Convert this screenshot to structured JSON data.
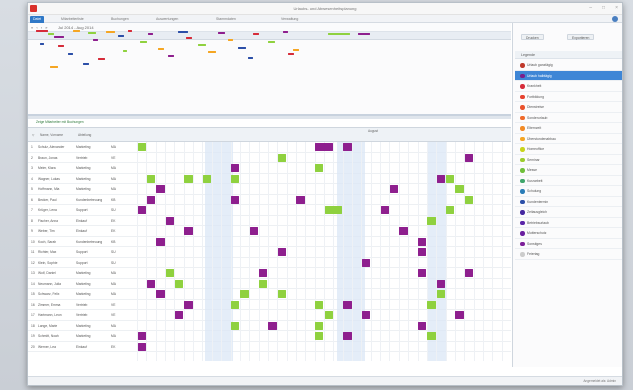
{
  "window": {
    "title": "Urlaubs- und Abwesenheitsplanung"
  },
  "ribbon": {
    "tabs": [
      {
        "label": "Datei",
        "active": true
      },
      {
        "label": "Mitarbeiterliste",
        "active": false
      },
      {
        "label": "Buchungen",
        "active": false
      },
      {
        "label": "Auswertungen",
        "active": false
      },
      {
        "label": "Stammdaten",
        "active": false
      },
      {
        "label": "Verwaltung",
        "active": false
      }
    ]
  },
  "nav": {
    "range": "Jul 2014 - Aug 2014"
  },
  "grid": {
    "caption": "Zeige Mitarbeiter mit Buchungen",
    "headers": {
      "name": "Name, Vorname",
      "dept": "Abteilung",
      "month": "August"
    },
    "rows": [
      {
        "n": "1",
        "name": "Schulz, Alexander",
        "dept": "Marketing",
        "code": "MA"
      },
      {
        "n": "2",
        "name": "Braun, Jonas",
        "dept": "Vertrieb",
        "code": "VE"
      },
      {
        "n": "3",
        "name": "Meier, Klara",
        "dept": "Marketing",
        "code": "MA"
      },
      {
        "n": "4",
        "name": "Wagner, Lukas",
        "dept": "Marketing",
        "code": "MA"
      },
      {
        "n": "5",
        "name": "Hoffmann, Mia",
        "dept": "Marketing",
        "code": "MA"
      },
      {
        "n": "6",
        "name": "Becker, Paul",
        "dept": "Kundenbetreuung",
        "code": "KB"
      },
      {
        "n": "7",
        "name": "Krüger, Lena",
        "dept": "Support",
        "code": "SU"
      },
      {
        "n": "8",
        "name": "Fischer, Anna",
        "dept": "Einkauf",
        "code": "EK"
      },
      {
        "n": "9",
        "name": "Weber, Tim",
        "dept": "Einkauf",
        "code": "EK"
      },
      {
        "n": "10",
        "name": "Koch, Sarah",
        "dept": "Kundenbetreuung",
        "code": "KB"
      },
      {
        "n": "11",
        "name": "Richter, Max",
        "dept": "Support",
        "code": "SU"
      },
      {
        "n": "12",
        "name": "Klein, Sophie",
        "dept": "Support",
        "code": "SU"
      },
      {
        "n": "13",
        "name": "Wolf, Daniel",
        "dept": "Marketing",
        "code": "MA"
      },
      {
        "n": "14",
        "name": "Neumann, Julia",
        "dept": "Marketing",
        "code": "MA"
      },
      {
        "n": "15",
        "name": "Schwarz, Felix",
        "dept": "Marketing",
        "code": "MA"
      },
      {
        "n": "16",
        "name": "Zimmer, Emma",
        "dept": "Vertrieb",
        "code": "VE"
      },
      {
        "n": "17",
        "name": "Hartmann, Leon",
        "dept": "Vertrieb",
        "code": "VE"
      },
      {
        "n": "18",
        "name": "Lange, Marie",
        "dept": "Marketing",
        "code": "MA"
      },
      {
        "n": "19",
        "name": "Schmitt, Noah",
        "dept": "Marketing",
        "code": "MA"
      },
      {
        "n": "20",
        "name": "Werner, Lea",
        "dept": "Einkauf",
        "code": "EK"
      }
    ]
  },
  "side_panel": {
    "buttons": {
      "left": "Drucken",
      "right": "Exportieren"
    },
    "header": "Legende",
    "items": [
      {
        "label": "Urlaub ganztägig",
        "color": "#c0392b",
        "selected": false
      },
      {
        "label": "Urlaub halbtägig",
        "color": "#7b1f8a",
        "selected": true
      },
      {
        "label": "Krankheit",
        "color": "#d62c3a",
        "selected": false
      },
      {
        "label": "Fortbildung",
        "color": "#e6422f",
        "selected": false
      },
      {
        "label": "Dienstreise",
        "color": "#e9522c",
        "selected": false
      },
      {
        "label": "Sonderurlaub",
        "color": "#ef6a2a",
        "selected": false
      },
      {
        "label": "Elternzeit",
        "color": "#f28a25",
        "selected": false
      },
      {
        "label": "Überstundenabbau",
        "color": "#f5a623",
        "selected": false
      },
      {
        "label": "Homeoffice",
        "color": "#c8d41c",
        "selected": false
      },
      {
        "label": "Seminar",
        "color": "#9ccc2d",
        "selected": false
      },
      {
        "label": "Messe",
        "color": "#6fbf3a",
        "selected": false
      },
      {
        "label": "Kurzarbeit",
        "color": "#3fa66b",
        "selected": false
      },
      {
        "label": "Schulung",
        "color": "#2a7db8",
        "selected": false
      },
      {
        "label": "Kundentermin",
        "color": "#2c4fa8",
        "selected": false
      },
      {
        "label": "Zeitausgleich",
        "color": "#4527a0",
        "selected": false
      },
      {
        "label": "Betriebsurlaub",
        "color": "#5a24a8",
        "selected": false
      },
      {
        "label": "Mutterschutz",
        "color": "#6a1fa0",
        "selected": false
      },
      {
        "label": "Sonstiges",
        "color": "#7d1f99",
        "selected": false
      },
      {
        "label": "Feiertag",
        "color": "#cccccc",
        "selected": false
      }
    ]
  },
  "status": {
    "right": "Angemeldet als: Admin"
  },
  "colors": {
    "purple": "#8e1f8e",
    "green": "#8fd13f",
    "accent": "#3e86d6"
  }
}
